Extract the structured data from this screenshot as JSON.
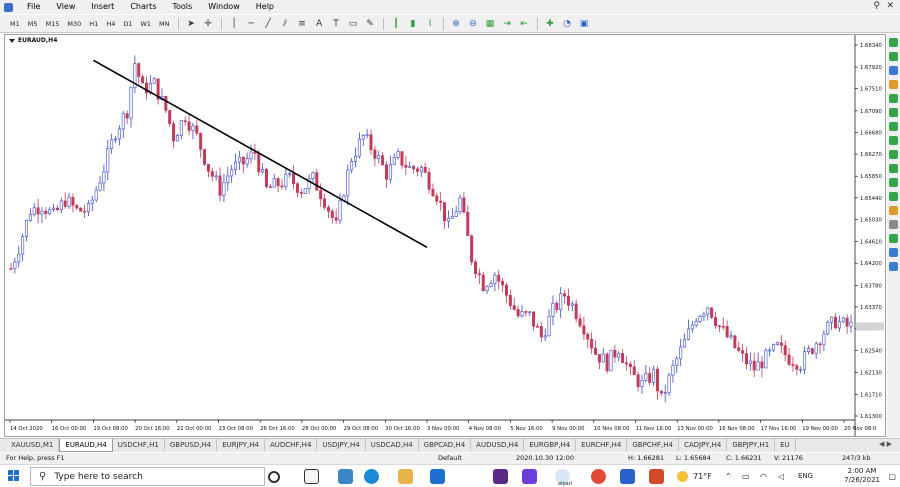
{
  "menu": {
    "items": [
      "File",
      "View",
      "Insert",
      "Charts",
      "Tools",
      "Window",
      "Help"
    ]
  },
  "toolbar": {
    "timeframes": [
      "M1",
      "M5",
      "M15",
      "M30",
      "H1",
      "H4",
      "D1",
      "W1",
      "MN"
    ]
  },
  "chart": {
    "title": "EURAUD,H4",
    "line_color": "#3a49c9",
    "trendline_color": "#000000"
  },
  "chart_data": {
    "type": "candlestick",
    "symbol": "EURAUD,H4",
    "y_ticks": [
      "1.68340",
      "1.67920",
      "1.67510",
      "1.67090",
      "1.66680",
      "1.66270",
      "1.65850",
      "1.65440",
      "1.65030",
      "1.64610",
      "1.64200",
      "1.63780",
      "1.63370",
      "1.62960",
      "1.62540",
      "1.62130",
      "1.61710",
      "1.61300"
    ],
    "ylim": [
      1.613,
      1.6834
    ],
    "x_ticks": [
      "14 Oct 2020",
      "16 Oct 00:00",
      "19 Oct 08:00",
      "20 Oct 16:00",
      "22 Oct 00:00",
      "23 Oct 08:00",
      "26 Oct 16:00",
      "28 Oct 00:00",
      "29 Oct 08:00",
      "30 Oct 16:00",
      "3 Nov 00:00",
      "4 Nov 08:00",
      "5 Nov 16:00",
      "9 Nov 00:00",
      "10 Nov 08:00",
      "11 Nov 16:00",
      "13 Nov 00:00",
      "16 Nov 08:00",
      "17 Nov 16:00",
      "19 Nov 00:00",
      "20 Nov 08:0"
    ],
    "close_path": [
      [
        0,
        1.641
      ],
      [
        2,
        1.645
      ],
      [
        5,
        1.652
      ],
      [
        8,
        1.653
      ],
      [
        11,
        1.651
      ],
      [
        14,
        1.654
      ],
      [
        17,
        1.652
      ],
      [
        20,
        1.652
      ],
      [
        24,
        1.66
      ],
      [
        27,
        1.667
      ],
      [
        30,
        1.671
      ],
      [
        32,
        1.68
      ],
      [
        34,
        1.675
      ],
      [
        37,
        1.676
      ],
      [
        40,
        1.671
      ],
      [
        42,
        1.666
      ],
      [
        45,
        1.67
      ],
      [
        48,
        1.666
      ],
      [
        51,
        1.66
      ],
      [
        54,
        1.656
      ],
      [
        57,
        1.66
      ],
      [
        60,
        1.661
      ],
      [
        63,
        1.663
      ],
      [
        66,
        1.656
      ],
      [
        69,
        1.657
      ],
      [
        72,
        1.658
      ],
      [
        75,
        1.656
      ],
      [
        78,
        1.658
      ],
      [
        81,
        1.654
      ],
      [
        84,
        1.649
      ],
      [
        86,
        1.656
      ],
      [
        88,
        1.662
      ],
      [
        91,
        1.666
      ],
      [
        94,
        1.663
      ],
      [
        97,
        1.659
      ],
      [
        100,
        1.662
      ],
      [
        103,
        1.66
      ],
      [
        106,
        1.66
      ],
      [
        110,
        1.655
      ],
      [
        113,
        1.649
      ],
      [
        116,
        1.654
      ],
      [
        119,
        1.643
      ],
      [
        122,
        1.638
      ],
      [
        125,
        1.64
      ],
      [
        128,
        1.636
      ],
      [
        131,
        1.632
      ],
      [
        134,
        1.632
      ],
      [
        137,
        1.628
      ],
      [
        140,
        1.633
      ],
      [
        143,
        1.636
      ],
      [
        145,
        1.634
      ],
      [
        148,
        1.63
      ],
      [
        151,
        1.625
      ],
      [
        154,
        1.623
      ],
      [
        157,
        1.626
      ],
      [
        160,
        1.621
      ],
      [
        163,
        1.619
      ],
      [
        166,
        1.621
      ],
      [
        168,
        1.616
      ],
      [
        171,
        1.622
      ],
      [
        174,
        1.627
      ],
      [
        177,
        1.632
      ],
      [
        180,
        1.634
      ],
      [
        183,
        1.63
      ],
      [
        186,
        1.627
      ],
      [
        189,
        1.624
      ],
      [
        192,
        1.622
      ],
      [
        195,
        1.624
      ],
      [
        198,
        1.626
      ],
      [
        201,
        1.624
      ],
      [
        204,
        1.623
      ],
      [
        207,
        1.626
      ],
      [
        210,
        1.629
      ],
      [
        213,
        1.631
      ],
      [
        216,
        1.63
      ]
    ],
    "trendline": {
      "start": [
        "19 Oct 08:00",
        1.6805
      ],
      "end": [
        "3 Nov 00:00",
        1.645
      ]
    },
    "candle_count": 218
  },
  "sidepanel": {
    "icons": [
      "green-flag-icon",
      "green-flag-icon",
      "blue-window-icon",
      "orange-folder-icon",
      "green-flag-icon",
      "green-flag-icon",
      "green-flag-icon",
      "green-flag-icon",
      "green-flag-icon",
      "green-flag-icon",
      "green-flag-icon",
      "green-flag-icon",
      "orange-folder-icon",
      "gray-lock-icon",
      "green-flag-icon",
      "blue-window-icon",
      "blue-window-icon"
    ]
  },
  "tabs": {
    "items": [
      "XAUUSD,M1",
      "EURAUD,H4",
      "USDCHF,H1",
      "GBPUSD,H4",
      "EURJPY,H4",
      "AUDCHF,H4",
      "USDJPY,H4",
      "USDCAD,H4",
      "GBPCAD,H4",
      "AUDUSD,H4",
      "EURGBP,H4",
      "EURCHF,H4",
      "GBPCHF,H4",
      "CADJPY,H4",
      "GBPJPY,H1",
      "EU"
    ],
    "active_index": 1
  },
  "status": {
    "help": "For Help, press F1",
    "profile": "Default",
    "datetime": "2020.10.30 12:00",
    "high": "H: 1.66281",
    "low": "L: 1.65684",
    "close": "C: 1.66231",
    "volume": "V: 21176",
    "traffic": "247/3 kb"
  },
  "taskbar": {
    "search_placeholder": "Type here to search",
    "weather": "71°F",
    "language": "ENG",
    "time": "2:00 AM",
    "date": "7/26/2021",
    "alpari_label": "alpari"
  }
}
